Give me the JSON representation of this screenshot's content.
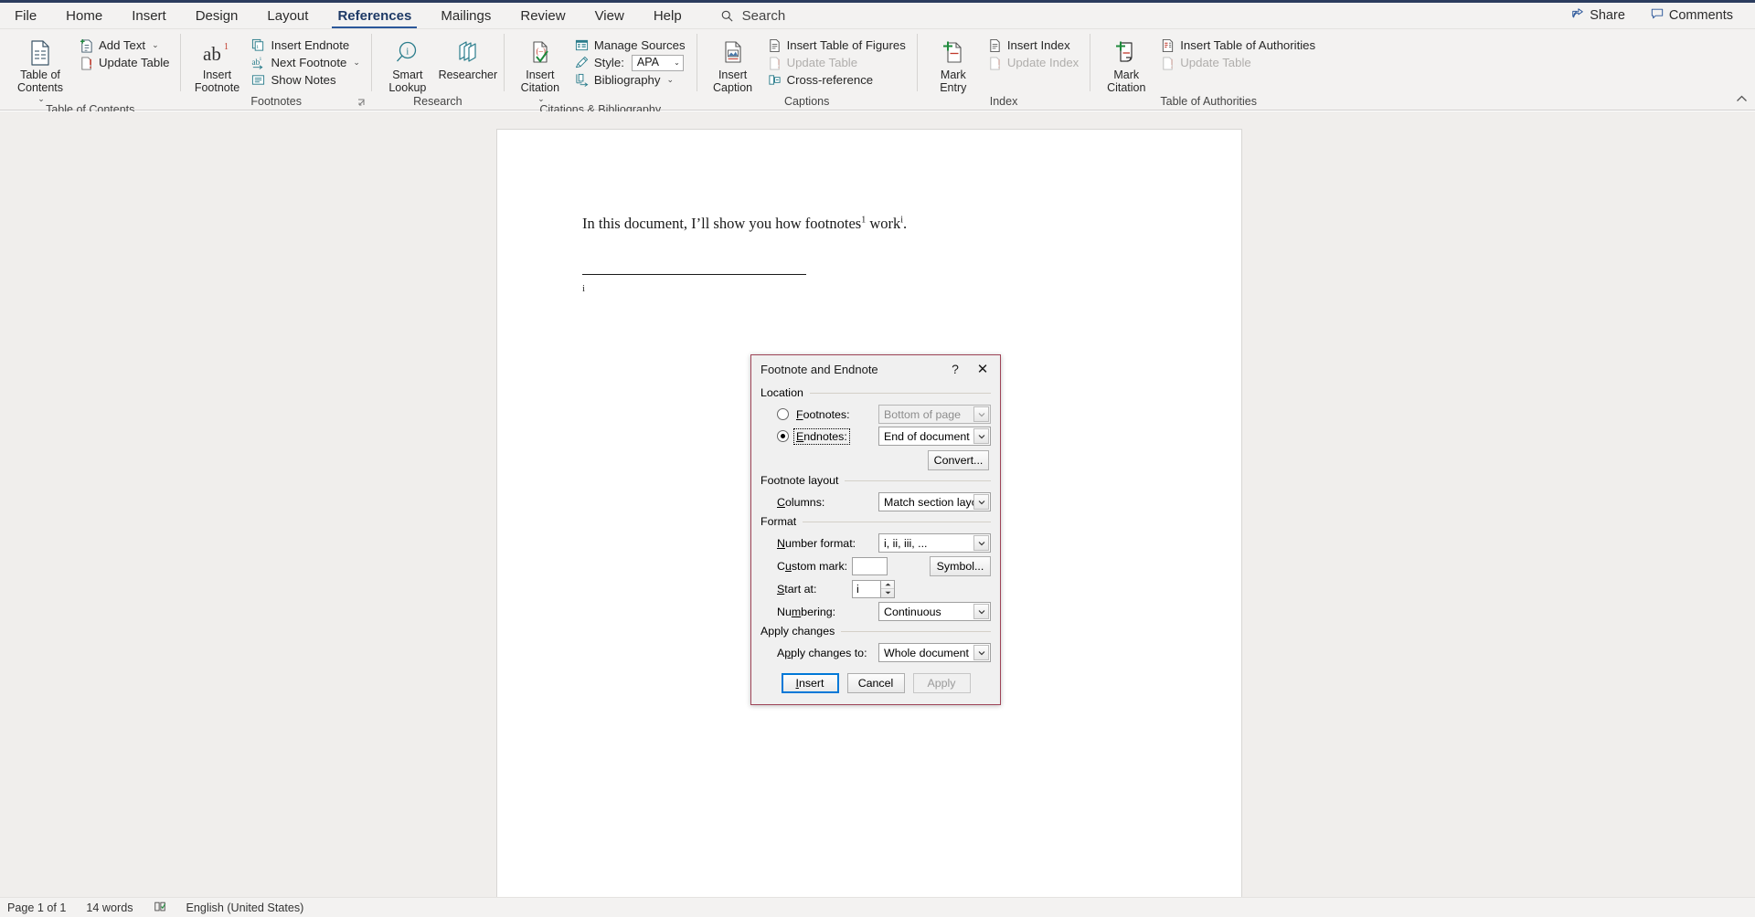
{
  "titlebar": {
    "accent_color": "#2b3c5e"
  },
  "tabs": [
    {
      "label": "File",
      "active": false
    },
    {
      "label": "Home",
      "active": false
    },
    {
      "label": "Insert",
      "active": false
    },
    {
      "label": "Design",
      "active": false
    },
    {
      "label": "Layout",
      "active": false
    },
    {
      "label": "References",
      "active": true
    },
    {
      "label": "Mailings",
      "active": false
    },
    {
      "label": "Review",
      "active": false
    },
    {
      "label": "View",
      "active": false
    },
    {
      "label": "Help",
      "active": false
    }
  ],
  "search": {
    "label": "Search",
    "icon": "search-icon"
  },
  "tabbar_right": [
    {
      "label": "Share",
      "icon": "share-icon"
    },
    {
      "label": "Comments",
      "icon": "comment-icon"
    }
  ],
  "ribbon": {
    "groups": [
      {
        "name": "table-of-contents",
        "label": "Table of Contents",
        "big": [
          {
            "label": "Table of\nContents",
            "icon": "toc-icon",
            "dropdown": true
          }
        ],
        "small": [
          {
            "label": "Add Text",
            "icon": "add-text-icon",
            "dropdown": true,
            "disabled": false
          },
          {
            "label": "Update Table",
            "icon": "update-table-icon",
            "dropdown": false,
            "disabled": false
          }
        ]
      },
      {
        "name": "footnotes",
        "label": "Footnotes",
        "big": [
          {
            "label": "Insert\nFootnote",
            "icon": "ab-footnote-icon",
            "dropdown": false
          }
        ],
        "small": [
          {
            "label": "Insert Endnote",
            "icon": "insert-endnote-icon",
            "dropdown": false,
            "disabled": false
          },
          {
            "label": "Next Footnote",
            "icon": "next-footnote-icon",
            "dropdown": true,
            "disabled": false
          },
          {
            "label": "Show Notes",
            "icon": "show-notes-icon",
            "dropdown": false,
            "disabled": false
          }
        ],
        "has_launcher": true
      },
      {
        "name": "research",
        "label": "Research",
        "big": [
          {
            "label": "Smart\nLookup",
            "icon": "smart-lookup-icon",
            "dropdown": false
          },
          {
            "label": "Researcher",
            "icon": "researcher-icon",
            "dropdown": false
          }
        ],
        "small": []
      },
      {
        "name": "citations-bibliography",
        "label": "Citations & Bibliography",
        "big": [
          {
            "label": "Insert\nCitation",
            "icon": "insert-citation-icon",
            "dropdown": true
          }
        ],
        "small": [
          {
            "label": "Manage Sources",
            "icon": "manage-sources-icon",
            "dropdown": false,
            "disabled": false
          },
          {
            "label": "Style:",
            "icon": "style-icon",
            "combo": {
              "name": "style-combo",
              "value": "APA"
            },
            "disabled": false
          },
          {
            "label": "Bibliography",
            "icon": "bibliography-icon",
            "dropdown": true,
            "disabled": false
          }
        ]
      },
      {
        "name": "captions",
        "label": "Captions",
        "big": [
          {
            "label": "Insert\nCaption",
            "icon": "insert-caption-icon",
            "dropdown": false
          }
        ],
        "small": [
          {
            "label": "Insert Table of Figures",
            "icon": "insert-table-figures-icon",
            "dropdown": false,
            "disabled": false
          },
          {
            "label": "Update Table",
            "icon": "update-table-icon",
            "dropdown": false,
            "disabled": true
          },
          {
            "label": "Cross-reference",
            "icon": "cross-reference-icon",
            "dropdown": false,
            "disabled": false
          }
        ]
      },
      {
        "name": "index",
        "label": "Index",
        "big": [
          {
            "label": "Mark\nEntry",
            "icon": "mark-entry-icon",
            "dropdown": false
          }
        ],
        "small": [
          {
            "label": "Insert Index",
            "icon": "insert-index-icon",
            "dropdown": false,
            "disabled": false
          },
          {
            "label": "Update Index",
            "icon": "update-index-icon",
            "dropdown": false,
            "disabled": true
          }
        ]
      },
      {
        "name": "table-of-authorities",
        "label": "Table of Authorities",
        "big": [
          {
            "label": "Mark\nCitation",
            "icon": "mark-citation-icon",
            "dropdown": false
          }
        ],
        "small": [
          {
            "label": "Insert Table of Authorities",
            "icon": "insert-table-authorities-icon",
            "dropdown": false,
            "disabled": false
          },
          {
            "label": "Update Table",
            "icon": "update-table-icon",
            "dropdown": false,
            "disabled": true
          }
        ]
      }
    ]
  },
  "document": {
    "body_text": "In this document, I’ll show you how footnotes",
    "sup1": "1",
    "body_text_2": " work",
    "sup2": "i",
    "body_text_3": ".",
    "endnote_mark": "i"
  },
  "dialog": {
    "title": "Footnote and Endnote",
    "help_glyph": "?",
    "close_glyph": "✕",
    "location": {
      "legend": "Location",
      "footnotes": {
        "label": "Footnotes:",
        "label_u": "F",
        "label_rest": "ootnotes:",
        "selected": false,
        "combo_value": "Bottom of page",
        "disabled": true
      },
      "endnotes": {
        "label": "Endnotes:",
        "label_u": "E",
        "label_rest": "ndnotes:",
        "selected": true,
        "focused": true,
        "combo_value": "End of document",
        "disabled": false
      },
      "convert_button": "Convert..."
    },
    "footnote_layout": {
      "legend": "Footnote layout",
      "columns_label": "Columns:",
      "columns_label_u": "C",
      "columns_value": "Match section layout"
    },
    "format": {
      "legend": "Format",
      "number_format_label": "Number format:",
      "number_format_value": "i, ii, iii, ...",
      "custom_mark_label": "Custom mark:",
      "custom_mark_value": "",
      "symbol_button": "Symbol...",
      "start_at_label": "Start at:",
      "start_at_value": "i",
      "numbering_label": "Numbering:",
      "numbering_value": "Continuous"
    },
    "apply_changes": {
      "legend": "Apply changes",
      "apply_to_label": "Apply changes to:",
      "apply_to_value": "Whole document"
    },
    "buttons": {
      "insert": "Insert",
      "cancel": "Cancel",
      "apply": "Apply",
      "apply_disabled": true,
      "insert_default": true
    },
    "border_color": "#9e4457",
    "default_button_color": "#0078d7"
  },
  "statusbar": {
    "page": "Page 1 of 1",
    "words": "14 words",
    "proofing_icon": "proofing-icon",
    "language": "English (United States)"
  }
}
